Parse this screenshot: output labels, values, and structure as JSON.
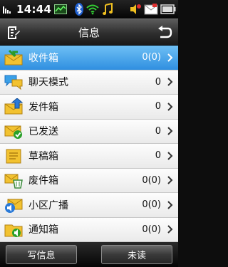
{
  "status_bar": {
    "time": "14:44",
    "icons": [
      "signal-activity-icon",
      "bluetooth-icon",
      "wifi-icon",
      "music-icon",
      "speaker-icon",
      "message-icon",
      "battery-icon"
    ]
  },
  "title_bar": {
    "title": "信息",
    "left_icon": "edit-list-icon",
    "right_icon": "back-icon"
  },
  "folders": [
    {
      "label": "收件箱",
      "count": "0(0)",
      "icon": "inbox-icon",
      "selected": true
    },
    {
      "label": "聊天模式",
      "count": "0",
      "icon": "chat-icon",
      "selected": false
    },
    {
      "label": "发件箱",
      "count": "0",
      "icon": "outbox-icon",
      "selected": false
    },
    {
      "label": "已发送",
      "count": "0",
      "icon": "sent-icon",
      "selected": false
    },
    {
      "label": "草稿箱",
      "count": "0",
      "icon": "drafts-icon",
      "selected": false
    },
    {
      "label": "废件箱",
      "count": "0(0)",
      "icon": "trash-icon",
      "selected": false
    },
    {
      "label": "小区广播",
      "count": "0(0)",
      "icon": "cell-broadcast-icon",
      "selected": false
    },
    {
      "label": "通知箱",
      "count": "0(0)",
      "icon": "notification-icon",
      "selected": false
    }
  ],
  "bottom_bar": {
    "left_key": "写信息",
    "right_key": "未读"
  },
  "colors": {
    "selected_row": "#2f8fe0",
    "envelope": "#f2c230"
  }
}
